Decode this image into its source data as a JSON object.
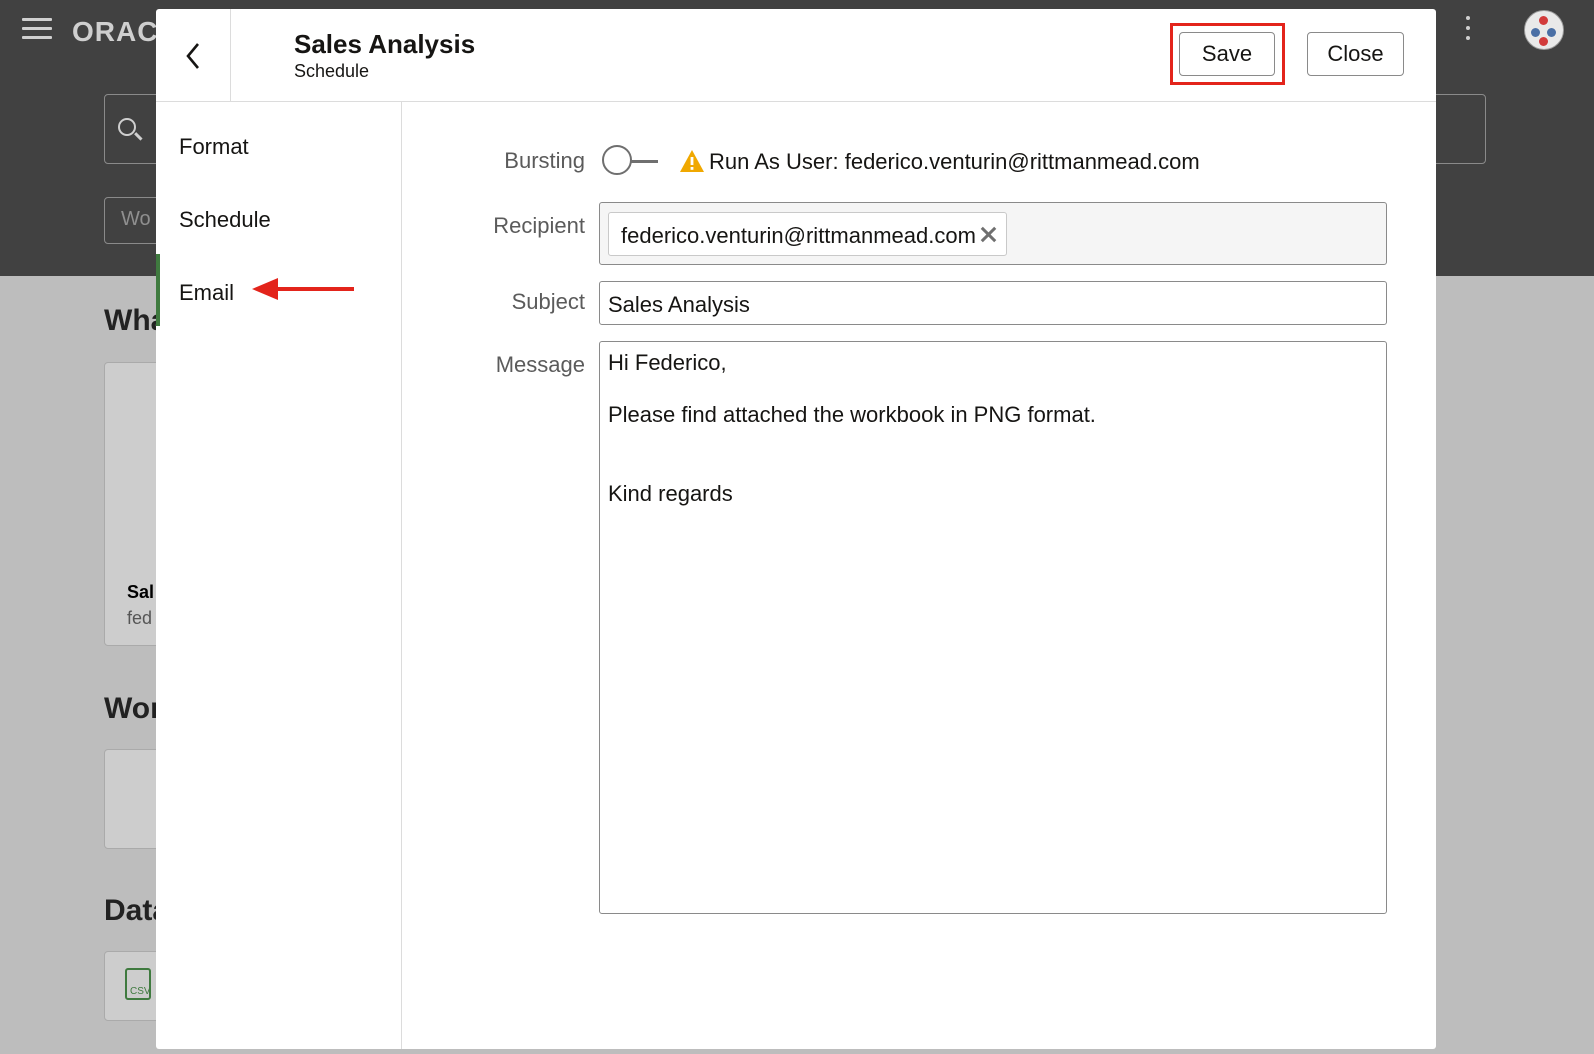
{
  "app": {
    "brand": "ORACLE",
    "filter_placeholder": "Wo",
    "sections": [
      "What",
      "Wor",
      "Data"
    ],
    "card_title": "Sal",
    "card_owner": "fed",
    "file_badge": "CSV"
  },
  "dialog": {
    "title": "Sales Analysis",
    "subtitle": "Schedule",
    "save_label": "Save",
    "close_label": "Close"
  },
  "nav": {
    "items": [
      {
        "label": "Format"
      },
      {
        "label": "Schedule"
      },
      {
        "label": "Email",
        "active": true
      }
    ]
  },
  "form": {
    "bursting_label": "Bursting",
    "bursting_on": false,
    "run_as_text": "Run As User: federico.venturin@rittmanmead.com",
    "recipient_label": "Recipient",
    "recipients": [
      "federico.venturin@rittmanmead.com"
    ],
    "subject_label": "Subject",
    "subject_value": "Sales Analysis",
    "message_label": "Message",
    "message_lines": [
      "Hi Federico,",
      "",
      "Please find attached the workbook in PNG format.",
      "",
      "",
      "Kind regards"
    ]
  },
  "colors": {
    "highlight": "#e3241b",
    "annotation_arrow": "#e3241b",
    "active_nav": "#3f7a3f",
    "warning": "#f0a800"
  }
}
